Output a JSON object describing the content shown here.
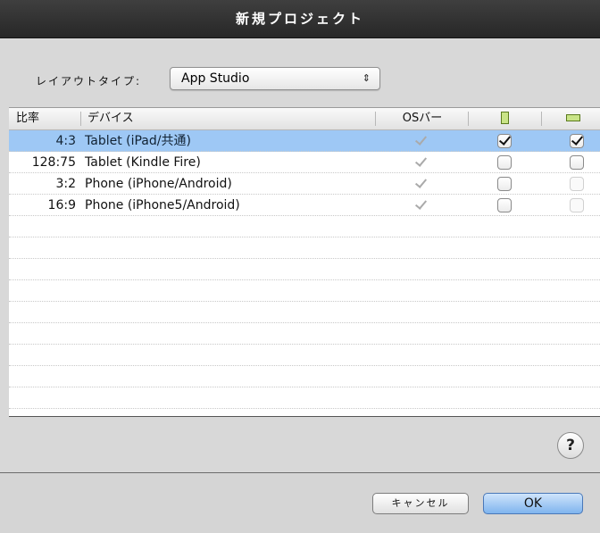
{
  "window": {
    "title": "新規プロジェクト"
  },
  "layout": {
    "label": "レイアウトタイプ:",
    "selected": "App Studio",
    "arrow_glyph": "⇕"
  },
  "table": {
    "columns": {
      "ratio": "比率",
      "device": "デバイス",
      "os_bar": "OSバー",
      "portrait_icon": "portrait-icon",
      "landscape_icon": "landscape-icon"
    },
    "rows": [
      {
        "ratio": "4:3",
        "device": "Tablet (iPad/共通)",
        "os_bar": "checked-disabled",
        "portrait": "checked",
        "landscape": "checked",
        "selected": true
      },
      {
        "ratio": "128:75",
        "device": "Tablet (Kindle Fire)",
        "os_bar": "checked-disabled",
        "portrait": "unchecked",
        "landscape": "unchecked",
        "selected": false
      },
      {
        "ratio": "3:2",
        "device": "Phone (iPhone/Android)",
        "os_bar": "checked-disabled",
        "portrait": "unchecked",
        "landscape": "disabled",
        "selected": false
      },
      {
        "ratio": "16:9",
        "device": "Phone (iPhone5/Android)",
        "os_bar": "checked-disabled",
        "portrait": "unchecked",
        "landscape": "disabled",
        "selected": false
      }
    ]
  },
  "help": {
    "label": "?"
  },
  "buttons": {
    "cancel": "キャンセル",
    "ok": "OK"
  },
  "colors": {
    "selection": "#9ec8f5",
    "titlebar": "#2f2f2f",
    "ok_button": "#7fb4ee"
  }
}
